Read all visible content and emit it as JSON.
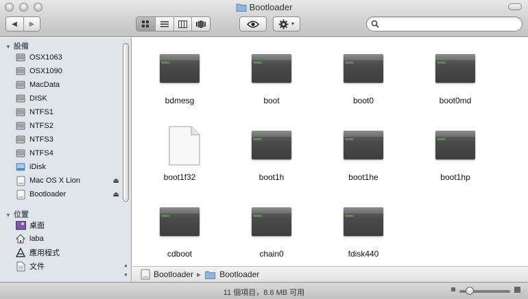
{
  "window": {
    "title": "Bootloader"
  },
  "toolbar": {
    "back_icon": "chevron-left-icon",
    "forward_icon": "chevron-right-icon",
    "view_modes": [
      "icon-view",
      "list-view",
      "column-view",
      "coverflow-view"
    ],
    "active_view": "icon-view",
    "quicklook_icon": "eye-icon",
    "action_icon": "gear-icon",
    "search": {
      "value": "",
      "placeholder": ""
    }
  },
  "sidebar": {
    "devices_header": "設備",
    "devices": [
      {
        "label": "OSX1063",
        "icon": "hard-drive-icon",
        "eject": false
      },
      {
        "label": "OSX1090",
        "icon": "hard-drive-icon",
        "eject": false
      },
      {
        "label": "MacData",
        "icon": "hard-drive-icon",
        "eject": false
      },
      {
        "label": "DISK",
        "icon": "hard-drive-icon",
        "eject": false
      },
      {
        "label": "NTFS1",
        "icon": "hard-drive-icon",
        "eject": false
      },
      {
        "label": "NTFS2",
        "icon": "hard-drive-icon",
        "eject": false
      },
      {
        "label": "NTFS3",
        "icon": "hard-drive-icon",
        "eject": false
      },
      {
        "label": "NTFS4",
        "icon": "hard-drive-icon",
        "eject": false
      },
      {
        "label": "iDisk",
        "icon": "idisk-icon",
        "eject": false
      },
      {
        "label": "Mac OS X Lion",
        "icon": "disk-image-icon",
        "eject": true
      },
      {
        "label": "Bootloader",
        "icon": "disk-image-icon",
        "eject": true
      }
    ],
    "places_header": "位置",
    "places": [
      {
        "label": "桌面",
        "icon": "desktop-icon"
      },
      {
        "label": "laba",
        "icon": "home-icon"
      },
      {
        "label": "應用程式",
        "icon": "applications-icon"
      },
      {
        "label": "文件",
        "icon": "documents-icon"
      }
    ]
  },
  "files": [
    {
      "name": "bdmesg",
      "kind": "exec"
    },
    {
      "name": "boot",
      "kind": "exec"
    },
    {
      "name": "boot0",
      "kind": "exec"
    },
    {
      "name": "boot0md",
      "kind": "exec"
    },
    {
      "name": "boot1f32",
      "kind": "document"
    },
    {
      "name": "boot1h",
      "kind": "exec"
    },
    {
      "name": "boot1he",
      "kind": "exec"
    },
    {
      "name": "boot1hp",
      "kind": "exec"
    },
    {
      "name": "cdboot",
      "kind": "exec"
    },
    {
      "name": "chain0",
      "kind": "exec"
    },
    {
      "name": "fdisk440",
      "kind": "exec"
    }
  ],
  "exec_label": "exec",
  "pathbar": {
    "segments": [
      "Bootloader",
      "Bootloader"
    ]
  },
  "status": {
    "text": "11 個項目，8.6 MB 可用",
    "icon_size_fraction": 0.2
  }
}
